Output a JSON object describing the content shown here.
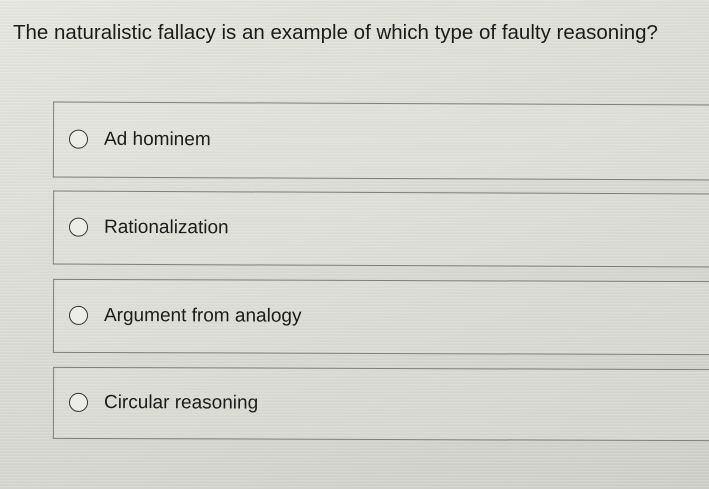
{
  "question": {
    "text": "The naturalistic fallacy is an example of which type of faulty reasoning?"
  },
  "options": [
    {
      "label": "Ad hominem",
      "selected": false
    },
    {
      "label": "Rationalization",
      "selected": false
    },
    {
      "label": "Argument from analogy",
      "selected": false
    },
    {
      "label": "Circular reasoning",
      "selected": false
    }
  ]
}
